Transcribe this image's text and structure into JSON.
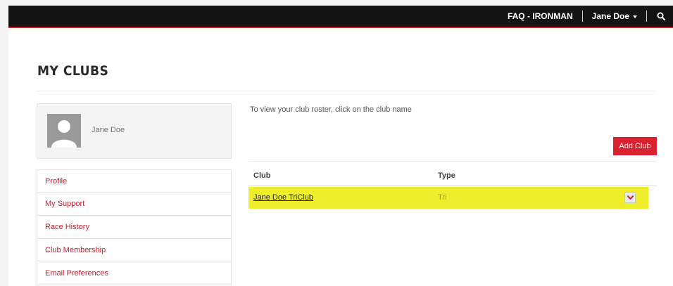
{
  "header": {
    "faq_label": "FAQ - IRONMAN",
    "user_label": "Jane Doe"
  },
  "page": {
    "title": "MY CLUBS"
  },
  "profile": {
    "name": "Jane Doe"
  },
  "sidebar": {
    "items": [
      {
        "label": "Profile"
      },
      {
        "label": "My Support"
      },
      {
        "label": "Race History"
      },
      {
        "label": "Club Membership"
      },
      {
        "label": "Email Preferences"
      }
    ]
  },
  "main": {
    "instructions": "To view your club roster, click on the club name",
    "add_club_label": "Add Club",
    "table": {
      "headers": {
        "club": "Club",
        "type": "Type"
      },
      "rows": [
        {
          "club": "Jane Doe TriClub",
          "type": "Tri",
          "highlighted": true
        }
      ]
    }
  },
  "colors": {
    "accent": "#d9212f",
    "topbar": "#141414",
    "highlight": "#eeee2c",
    "link": "#c8202f"
  },
  "icons": {
    "search": "search-icon",
    "avatar": "avatar-placeholder-icon",
    "expand": "chevron-down-icon",
    "user_menu": "caret-down-icon"
  }
}
